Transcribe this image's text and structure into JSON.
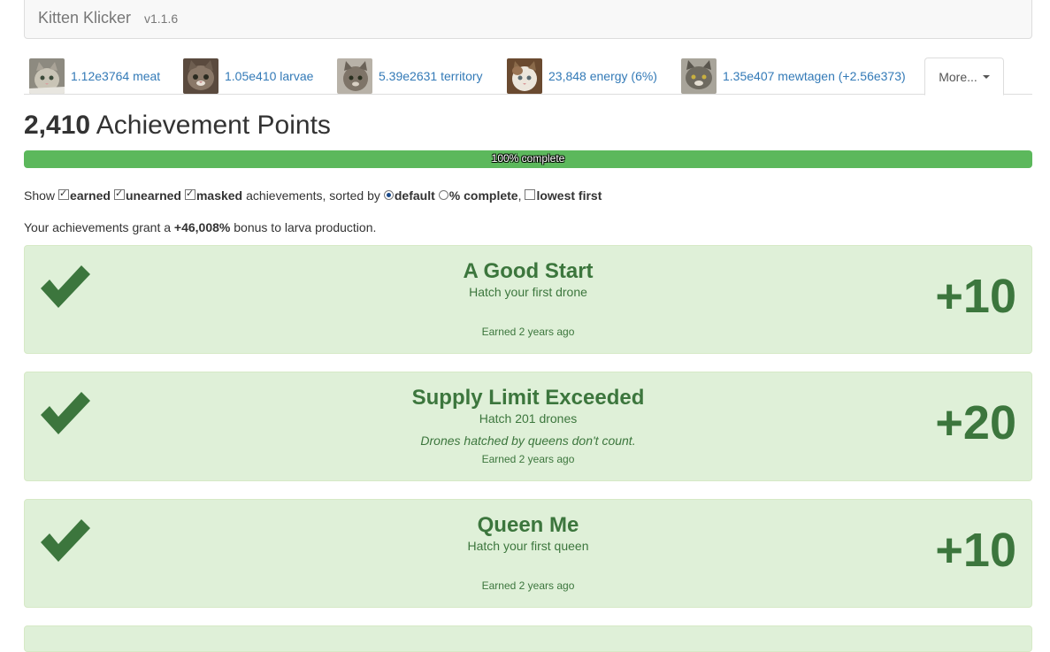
{
  "header": {
    "title": "Kitten Klicker",
    "version": "v1.1.6"
  },
  "tabs": [
    {
      "label": "1.12e3764 meat",
      "icon": "kitten-thumbnail-icon"
    },
    {
      "label": "1.05e410 larvae",
      "icon": "kitten-thumbnail-icon"
    },
    {
      "label": "5.39e2631 territory",
      "icon": "kitten-thumbnail-icon"
    },
    {
      "label": "23,848 energy (6%)",
      "icon": "kitten-thumbnail-icon"
    },
    {
      "label": "1.35e407 mewtagen (+2.56e373)",
      "icon": "kitten-thumbnail-icon"
    }
  ],
  "more_tab": {
    "label": "More..."
  },
  "points": {
    "value": "2,410",
    "label": "Achievement Points"
  },
  "progress": {
    "text": "100% complete",
    "percent": 100
  },
  "filters": {
    "show": "Show",
    "earned": "earned",
    "unearned": "unearned",
    "masked": "masked",
    "sorted_by": "achievements, sorted by",
    "default": "default",
    "pct_complete": "% complete",
    "lowest_first": "lowest first",
    "comma": ","
  },
  "bonus": {
    "prefix": "Your achievements grant a",
    "value": "+46,008%",
    "suffix": "bonus to larva production."
  },
  "achievements": [
    {
      "name": "A Good Start",
      "desc": "Hatch your first drone",
      "note": "",
      "earned": "Earned 2 years ago",
      "points": "+10"
    },
    {
      "name": "Supply Limit Exceeded",
      "desc": "Hatch 201 drones",
      "note": "Drones hatched by queens don't count.",
      "earned": "Earned 2 years ago",
      "points": "+20"
    },
    {
      "name": "Queen Me",
      "desc": "Hatch your first queen",
      "note": "",
      "earned": "Earned 2 years ago",
      "points": "+10"
    }
  ],
  "colors": {
    "link": "#337ab7",
    "success_bg": "#dff0d8",
    "success_text": "#3c763d",
    "progress": "#5cb85c"
  }
}
